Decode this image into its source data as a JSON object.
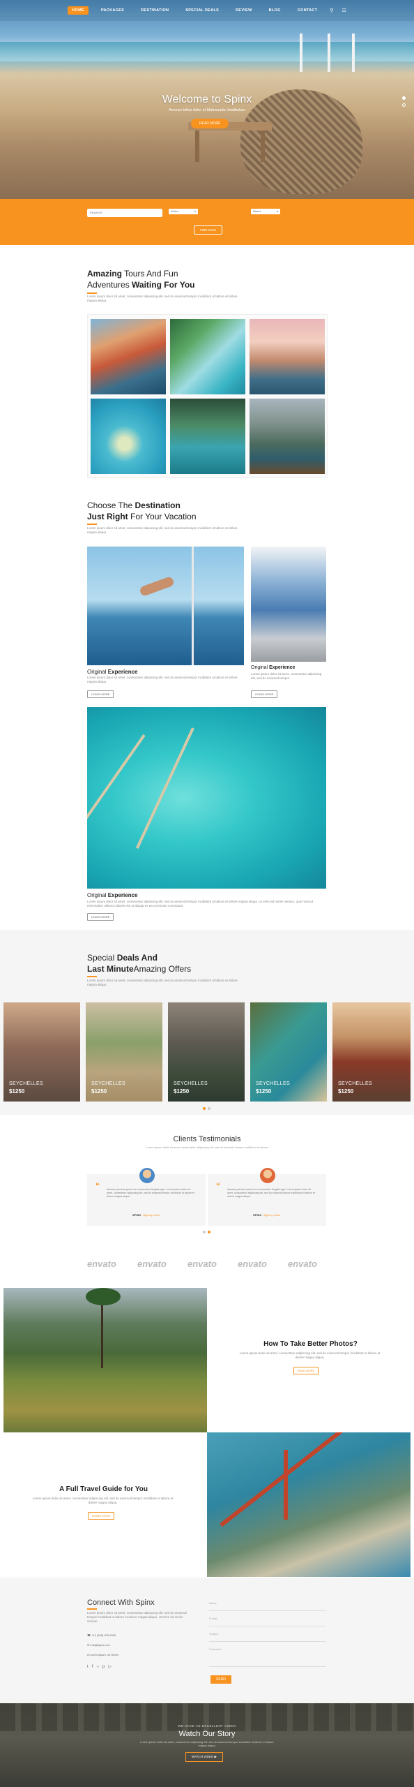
{
  "nav": {
    "items": [
      "HOME",
      "PACKAGES",
      "DESTINATION",
      "SPECIAL DEALS",
      "REVIEW",
      "BLOG",
      "CONTACT"
    ],
    "active_index": 0,
    "icons": [
      "search-icon",
      "cart-icon"
    ]
  },
  "hero": {
    "title": "Welcome to Spinx",
    "subtitle": "Aenean tellus dolor et Malesuada Vestibulum",
    "button": "READ MORE"
  },
  "search": {
    "keyword_placeholder": "Keyword",
    "select_1": "Select",
    "select_2": "Select",
    "button": "FIND NOW"
  },
  "tours": {
    "title_bold_1": "Amazing",
    "title_mid": " Tours And Fun",
    "title_line2": "Adventures ",
    "title_bold_2": "Waiting For You",
    "text": "Lorem ipsum dolor sit amet, consectetur adipiscing elit, sed do eiusmod tempor incididunt ut labore et dolore magna aliqua."
  },
  "destination": {
    "title_1": "Choose The ",
    "title_bold_1": "Destination",
    "title_bold_2": "Just Right",
    "title_2": " For Your Vacation",
    "text": "Lorem ipsum dolor sit amet, consectetur adipiscing elit, sed do eiusmod tempor incididunt ut labore et dolore magna aliqua.",
    "cards": [
      {
        "title": "Original ",
        "title_bold": "Experience",
        "text": "Lorem ipsum dolor sit amet, consectetur adipiscing elit, sed do eiusmod tempor incididunt ut labore et dolore magna aliqua.",
        "button": "LEARN MORE"
      },
      {
        "title": "Original ",
        "title_bold": "Experience",
        "text": "Lorem ipsum dolor sit amet, consectetur adipiscing elit, sed do eiusmod tempor.",
        "button": "LEARN MORE"
      },
      {
        "title": "Original ",
        "title_bold": "Experience",
        "text": "Lorem ipsum dolor sit amet, consectetur adipiscing elit, sed do eiusmod tempor incididunt ut labore et dolore magna aliqua. Ut enim ad minim veniam, quis nostrud exercitation ullamco laboris nisi ut aliquip ex ea commodo consequat.",
        "button": "LEARN MORE"
      }
    ]
  },
  "deals": {
    "title_1": "Special ",
    "title_bold_1": "Deals And",
    "title_bold_2": "Last Minute",
    "title_2": "Amazing Offers",
    "text": "Lorem ipsum dolor sit amet, consectetur adipiscing elit, sed do eiusmod tempor incididunt ut labore et dolore magna aliqua.",
    "items": [
      {
        "name": "SEYCHELLES",
        "price": "$1250"
      },
      {
        "name": "SEYCHELLES",
        "price": "$1250"
      },
      {
        "name": "SEYCHELLES",
        "price": "$1250"
      },
      {
        "name": "SEYCHELLES",
        "price": "$1250"
      },
      {
        "name": "SEYCHELLES",
        "price": "$1250"
      }
    ]
  },
  "testimonials": {
    "title": "Clients Testimonials",
    "text": "Lorem ipsum dolor sit amet, consectetur adipiscing elit, sed do eiusmod tempor incididunt ut labore",
    "items": [
      {
        "text": "Aenean pulvinar ipsum non consectetur fringilla eget. Lorem ipsum dolor sit amet, consectetur adipiscing elit, sed do eiusmod tempor incididunt ut labore et dolore magna aliqua.",
        "name": "SPINX",
        "role": " - Agency Lead"
      },
      {
        "text": "Aenean pulvinar ipsum non consectetur fringilla eget. Lorem ipsum dolor sit amet, consectetur adipiscing elit, sed do eiusmod tempor incididunt ut labore et dolore magna aliqua.",
        "name": "SPINX",
        "role": " - Agency Lead"
      }
    ]
  },
  "partners": [
    "envato",
    "envato",
    "envato",
    "envato",
    "envato"
  ],
  "blog": [
    {
      "title": "How To Take Better Photos?",
      "text": "Lorem ipsum dolor sit amet, consectetur adipiscing elit, sed do eiusmod tempor incididunt ut labore et dolore magna aliqua.",
      "button": "READ MORE"
    },
    {
      "title": "A Full Travel Guide for You",
      "text": "Lorem ipsum dolor sit amet, consectetur adipiscing elit, sed do eiusmod tempor incididunt ut labore et dolore magna aliqua.",
      "button": "LEARN MORE"
    }
  ],
  "connect": {
    "title": "Connect With Spinx",
    "text": "Lorem ipsum dolor sit amet, consectetur adipiscing elit, sed do eiusmod tempor incididunt ut labore et dolore magna aliqua. Ut enim ad minim veniam.",
    "phone": "+12 (345) 678 9900",
    "email": "info@spinx.com",
    "address": "Lorem ipsum, 15 Street",
    "fields": [
      "Name",
      "E-mail",
      "Subject",
      "Comment"
    ],
    "send": "SEND"
  },
  "video": {
    "kicker": "WE HAVE AN EXCELLENT VIDEO",
    "title": "Watch Our Story",
    "text": "Lorem ipsum dolor sit amet, consectetur adipiscing elit, sed do eiusmod tempor incididunt ut labore et dolore magna aliqua.",
    "button": "WATCH VIDEO"
  },
  "colors": {
    "accent": "#f7931e",
    "dark": "#222222",
    "muted": "#888888"
  }
}
